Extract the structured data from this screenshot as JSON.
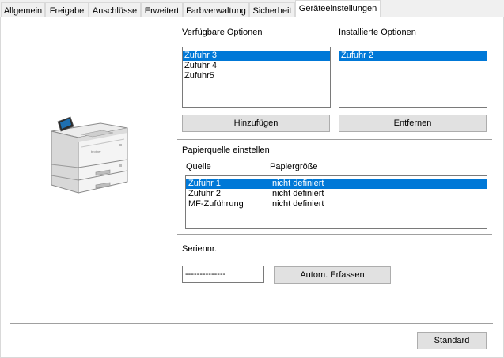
{
  "tabs": [
    "Allgemein",
    "Freigabe",
    "Anschlüsse",
    "Erweitert",
    "Farbverwaltung",
    "Sicherheit",
    "Geräteeinstellungen"
  ],
  "available": {
    "label": "Verfügbare Optionen",
    "items": [
      "Zufuhr 3",
      "Zufuhr 4",
      "Zufuhr5"
    ],
    "selected_index": 0
  },
  "installed": {
    "label": "Installierte Optionen",
    "items": [
      "Zufuhr 2"
    ],
    "selected_index": 0
  },
  "buttons": {
    "add": "Hinzufügen",
    "remove": "Entfernen",
    "auto_detect": "Autom. Erfassen",
    "standard": "Standard"
  },
  "paper_source": {
    "title": "Papierquelle einstellen",
    "col_source": "Quelle",
    "col_size": "Papiergröße",
    "rows": [
      {
        "source": "Zufuhr 1",
        "size": "nicht definiert"
      },
      {
        "source": "Zufuhr 2",
        "size": "nicht definiert"
      },
      {
        "source": "MF-Zuführung",
        "size": "nicht definiert"
      }
    ],
    "selected_index": 0
  },
  "serial": {
    "label": "Seriennr.",
    "value": "--------------"
  },
  "printer_brand": "brother",
  "colors": {
    "selection": "#0078d7"
  }
}
